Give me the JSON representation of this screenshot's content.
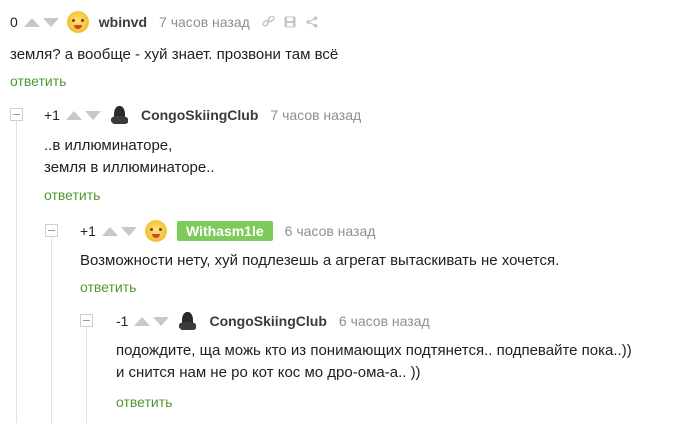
{
  "comments": [
    {
      "rating": "0",
      "author": "wbinvd",
      "time": "7 часов назад",
      "text_lines": [
        "земля? а вообще - хуй знает. прозвони там всё"
      ],
      "reply_label": "ответить",
      "tools": [
        "link-icon",
        "save-icon",
        "share-icon"
      ]
    },
    {
      "rating": "+1",
      "author": "CongoSkiingClub",
      "time": "7 часов назад",
      "text_lines": [
        "..в иллюминаторе,",
        "земля в иллюминаторе.."
      ],
      "reply_label": "ответить"
    },
    {
      "rating": "+1",
      "author": "Withasm1le",
      "time": "6 часов назад",
      "text_lines": [
        "Возможности нету, хуй подлезешь а агрегат вытаскивать не хочется."
      ],
      "reply_label": "ответить"
    },
    {
      "rating": "-1",
      "author": "CongoSkiingClub",
      "time": "6 часов назад",
      "text_lines": [
        "подождите, ща можь кто из понимающих подтянется.. подпевайте пока..))",
        "и снится нам не ро кот  кос мо дро-ома-а.. ))"
      ],
      "reply_label": "ответить"
    }
  ],
  "colors": {
    "reply_link": "#4f9a2d",
    "author_badge": "#7ecb5c",
    "vote_arrow": "#c8c8c8"
  }
}
